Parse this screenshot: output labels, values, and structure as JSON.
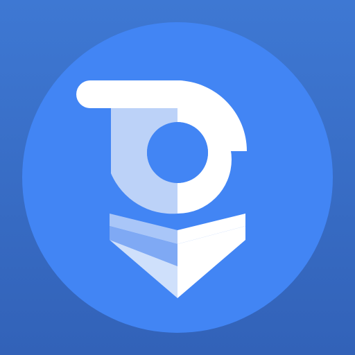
{
  "app_icon": {
    "icon_name": "app-logo-icon",
    "description_kind": "circular launcher icon",
    "colors": {
      "background_top": "#3E78D3",
      "background_bottom": "#3262B8",
      "circle_fill": "#4285F4",
      "ring_light": "#BCD2F8",
      "ring_white": "#FFFFFF",
      "chevron_upper_left": "#A9C6F8",
      "chevron_upper_right": "#FFFFFF",
      "chevron_middle_left": "#7FA9F4",
      "chevron_lower_left": "#CFE0FB",
      "chevron_lower_right": "#FFFFFF"
    }
  }
}
